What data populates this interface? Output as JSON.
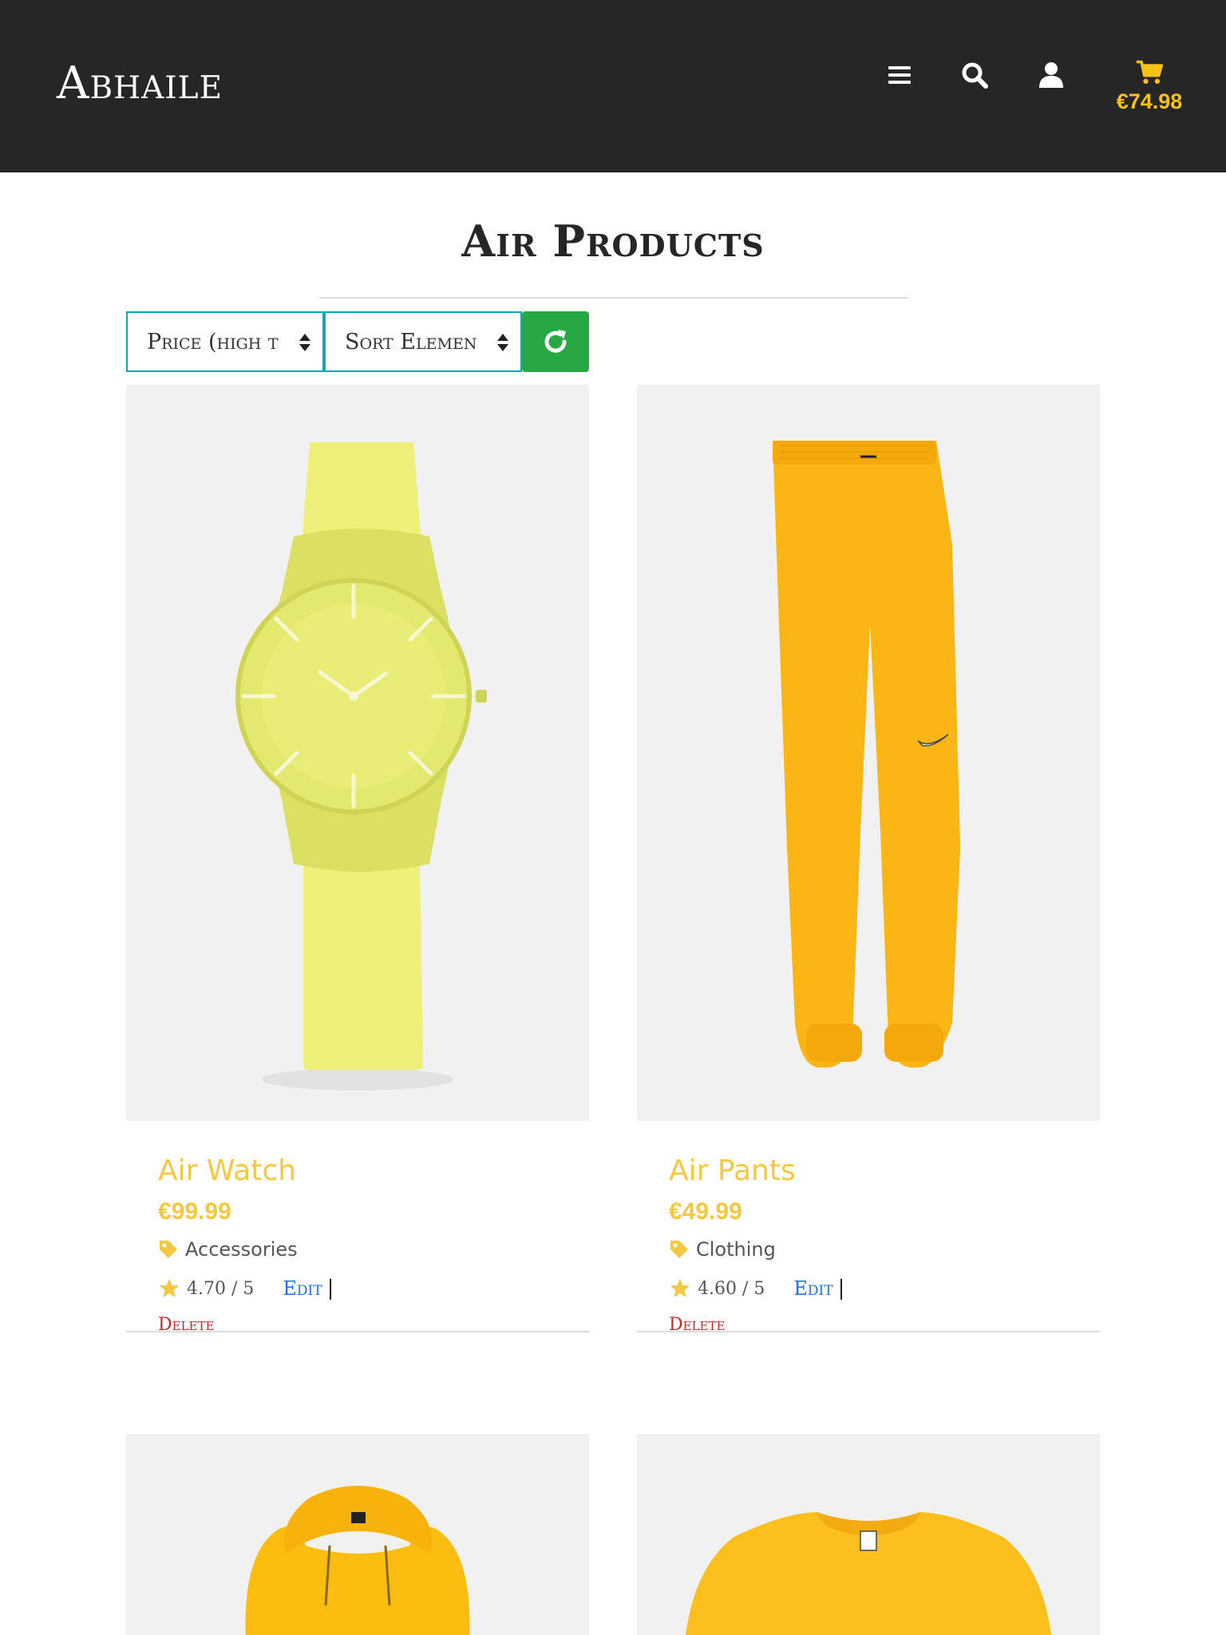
{
  "header": {
    "brand": "Abhaile",
    "cart_total": "€74.98",
    "icons": [
      "menu-icon",
      "search-icon",
      "user-icon",
      "cart-icon"
    ]
  },
  "page": {
    "title": "Air Products"
  },
  "controls": {
    "price_select": "Price (high t",
    "sort_select": "Sort Elemen",
    "refresh_icon": "refresh-icon"
  },
  "products": [
    {
      "name": "Air Watch",
      "price": "€99.99",
      "category": "Accessories",
      "rating": "4.70 / 5",
      "edit": "Edit",
      "delete": "Delete"
    },
    {
      "name": "Air Pants",
      "price": "€49.99",
      "category": "Clothing",
      "rating": "4.60 / 5",
      "edit": "Edit",
      "delete": "Delete"
    }
  ],
  "colors": {
    "header_bg": "#262626",
    "accent_yellow": "#f7c116",
    "product_text": "#f5c842",
    "edit_link": "#1a73e8",
    "delete_link": "#c62828",
    "select_border": "#17a2b8",
    "refresh_button": "#28a745"
  }
}
